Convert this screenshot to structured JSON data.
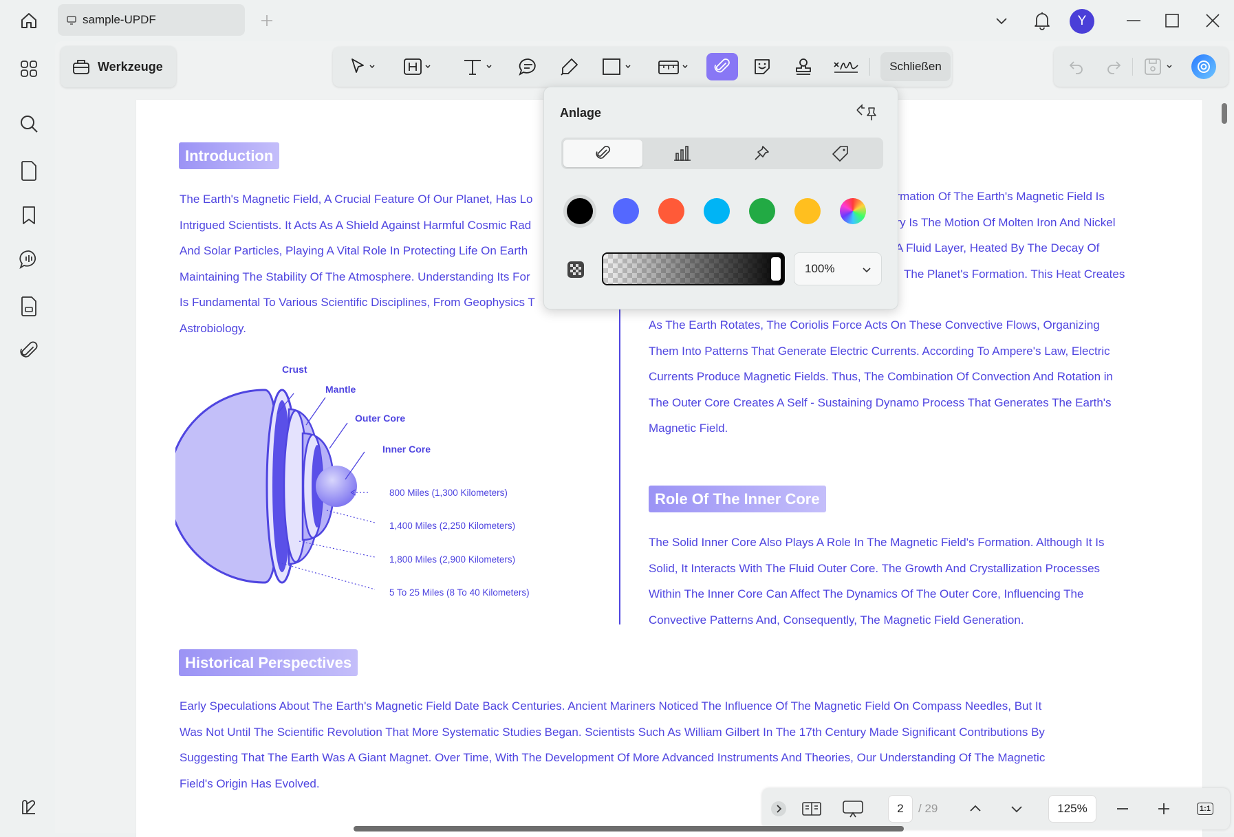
{
  "window": {
    "tab_title": "sample-UPDF",
    "avatar_initial": "Y"
  },
  "toolbar": {
    "tools_label": "Werkzeuge",
    "close_label": "Schließen"
  },
  "popup": {
    "title": "Anlage",
    "tabs": [
      "paperclip-icon",
      "chart-icon",
      "pin-icon",
      "tag-icon"
    ],
    "colors": [
      "#000000",
      "#5468ff",
      "#ff5a38",
      "#00b4f5",
      "#22aa44",
      "#ffbf1f",
      "gradient"
    ],
    "opacity": "100%"
  },
  "document": {
    "intro_heading": "Introduction",
    "intro_lines": [
      "The Earth's Magnetic Field, A Crucial Feature Of Our Planet, Has Lo",
      "Intrigued Scientists. It Acts As A Shield Against Harmful Cosmic Rad",
      "And Solar Particles, Playing A Vital Role In Protecting Life On Earth",
      "Maintaining The Stability Of The Atmosphere. Understanding Its For",
      "Is Fundamental To Various Scientific Disciplines, From Geophysics T",
      "Astrobiology."
    ],
    "right_top_lines": [
      "ormation Of The Earth's Magnetic Field Is",
      "ory Is The Motion Of Molten Iron And Nickel",
      "A Fluid Layer, Heated By The Decay Of",
      "The Planet's Formation. This Heat Creates"
    ],
    "rotation_lines": [
      "As The Earth Rotates, The Coriolis Force Acts On These Convective Flows, Organizing",
      "Them Into Patterns That Generate Electric Currents. According To Ampere's Law, Electric",
      "Currents Produce Magnetic Fields. Thus, The Combination Of Convection And Rotation in",
      "The Outer Core Creates A Self - Sustaining Dynamo Process That Generates The Earth's",
      "Magnetic Field."
    ],
    "inner_core_heading": "Role Of The Inner Core",
    "inner_core_lines": [
      "The Solid Inner Core Also Plays A Role In The Magnetic Field's Formation. Although It Is",
      "Solid, It Interacts With The Fluid Outer Core. The Growth And Crystallization Processes",
      "Within The Inner Core Can Affect The Dynamics Of The Outer Core, Influencing The",
      "Convective Patterns And, Consequently, The Magnetic Field Generation."
    ],
    "history_heading": "Historical Perspectives",
    "history_lines": [
      "Early Speculations About The Earth's Magnetic Field Date Back Centuries. Ancient Mariners Noticed The Influence Of The Magnetic Field On Compass Needles, But It",
      "Was Not Until The Scientific Revolution That More Systematic Studies Began. Scientists Such As William Gilbert In The 17th Century Made Significant Contributions By",
      "Suggesting That The Earth Was A Giant Magnet. Over Time, With The Development Of More Advanced Instruments And Theories, Our Understanding Of The Magnetic",
      "Field's Origin Has Evolved."
    ],
    "diagram": {
      "labels": {
        "crust": "Crust",
        "mantle": "Mantle",
        "outer_core": "Outer Core",
        "inner_core": "Inner Core"
      },
      "distances": [
        "800 Miles (1,300 Kilometers)",
        "1,400 Miles (2,250 Kilometers)",
        "1,800 Miles (2,900 Kilometers)",
        "5 To 25 Miles (8 To 40 Kilometers)"
      ]
    }
  },
  "bottom": {
    "current_page": "2",
    "total_pages": "/ 29",
    "zoom": "125%",
    "fit_label": "1:1"
  }
}
